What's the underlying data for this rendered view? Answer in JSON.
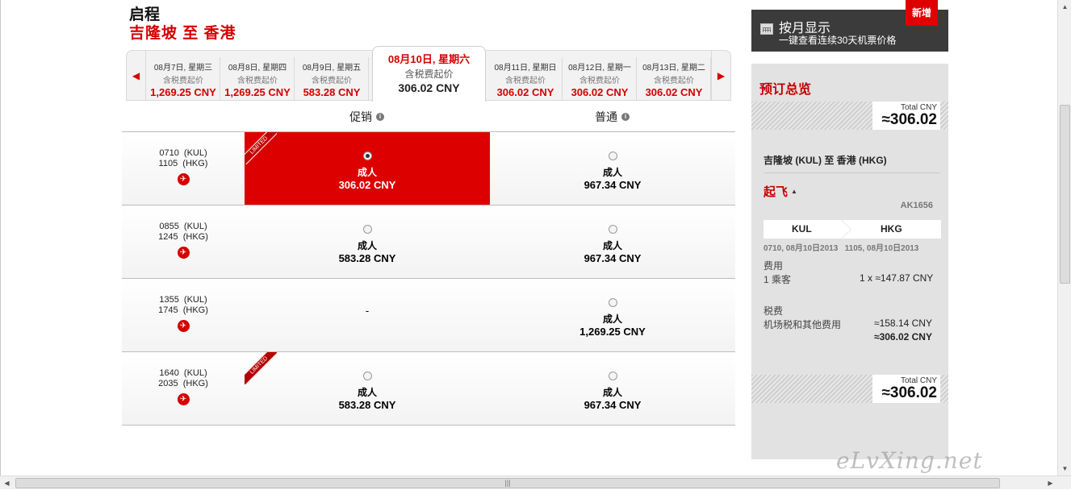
{
  "header": {
    "title": "启程",
    "route": "吉隆坡  至  香港"
  },
  "date_strip": {
    "subtitle": "含税费起价",
    "tabs": [
      {
        "date": "08月7日, 星期三",
        "price": "1,269.25 CNY"
      },
      {
        "date": "08月8日, 星期四",
        "price": "1,269.25 CNY"
      },
      {
        "date": "08月9日, 星期五",
        "price": "583.28 CNY"
      },
      {
        "date": "08月10日, 星期六",
        "price": "306.02 CNY",
        "active": true
      },
      {
        "date": "08月11日, 星期日",
        "price": "306.02 CNY"
      },
      {
        "date": "08月12日, 星期一",
        "price": "306.02 CNY"
      },
      {
        "date": "08月13日, 星期二",
        "price": "306.02 CNY"
      }
    ]
  },
  "fare_columns": {
    "promo": "促销",
    "normal": "普通"
  },
  "flights": [
    {
      "dep": "0710  (KUL)",
      "arr": "1105  (HKG)",
      "promo_label": "成人",
      "promo_price": "306.02 CNY",
      "normal_label": "成人",
      "normal_price": "967.34 CNY",
      "limited": "LIMITED"
    },
    {
      "dep": "0855  (KUL)",
      "arr": "1245  (HKG)",
      "promo_label": "成人",
      "promo_price": "583.28 CNY",
      "normal_label": "成人",
      "normal_price": "967.34 CNY"
    },
    {
      "dep": "1355  (KUL)",
      "arr": "1745  (HKG)",
      "promo_dash": "-",
      "normal_label": "成人",
      "normal_price": "1,269.25 CNY"
    },
    {
      "dep": "1640  (KUL)",
      "arr": "2035  (HKG)",
      "promo_label": "成人",
      "promo_price": "583.28 CNY",
      "normal_label": "成人",
      "normal_price": "967.34 CNY",
      "limited": "LIMITED"
    }
  ],
  "month_view": {
    "title": "按月显示",
    "subtitle": "一键查看连续30天机票价格",
    "badge": "新增"
  },
  "summary": {
    "title": "预订总览",
    "total_label": "Total CNY",
    "total_value": "≈306.02",
    "route": "吉隆坡 (KUL) 至 香港 (HKG)",
    "depart_label": "起飞",
    "flight_no": "AK1656",
    "from_code": "KUL",
    "to_code": "HKG",
    "times": "0710, 08月10日2013   1105, 08月10日2013",
    "fee_label": "费用",
    "passenger_label": "1 乘客",
    "passenger_value": "1 x ≈147.87 CNY",
    "tax_label": "税费",
    "airport_tax_label": "机场税和其他费用",
    "airport_tax_value": "≈158.14 CNY",
    "subtotal_value": "≈306.02 CNY"
  },
  "watermark": "eLvXing.net",
  "icons": {
    "prev": "left-arrow-icon",
    "next": "right-arrow-icon",
    "info": "info-icon",
    "plane": "plane-icon",
    "calendar": "calendar-icon"
  },
  "colors": {
    "brand_red": "#d40000",
    "selected": "#dd0000",
    "panel": "#e2e2e2",
    "dark_box": "#3b3b3b"
  }
}
